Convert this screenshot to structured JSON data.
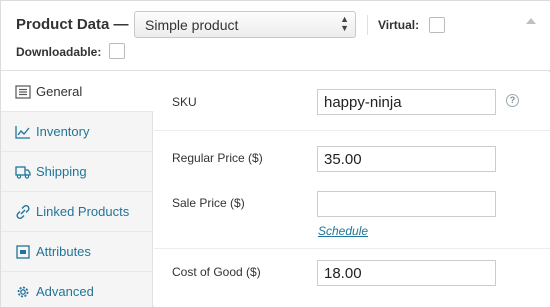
{
  "header": {
    "title": "Product Data —",
    "product_type": "Simple product",
    "virtual_label": "Virtual:",
    "downloadable_label": "Downloadable:"
  },
  "tabs": [
    {
      "label": "General",
      "icon": "list-icon",
      "active": true
    },
    {
      "label": "Inventory",
      "icon": "chart-icon",
      "active": false
    },
    {
      "label": "Shipping",
      "icon": "truck-icon",
      "active": false
    },
    {
      "label": "Linked Products",
      "icon": "link-icon",
      "active": false
    },
    {
      "label": "Attributes",
      "icon": "attributes-icon",
      "active": false
    },
    {
      "label": "Advanced",
      "icon": "gear-icon",
      "active": false
    }
  ],
  "fields": {
    "sku": {
      "label": "SKU",
      "value": "happy-ninja"
    },
    "regular_price": {
      "label": "Regular Price ($)",
      "value": "35.00"
    },
    "sale_price": {
      "label": "Sale Price ($)",
      "value": ""
    },
    "schedule_link": "Schedule",
    "cost_of_good": {
      "label": "Cost of Good ($)",
      "value": "18.00"
    }
  },
  "colors": {
    "link": "#21759b",
    "sidebar_bg": "#f5f5f5"
  }
}
